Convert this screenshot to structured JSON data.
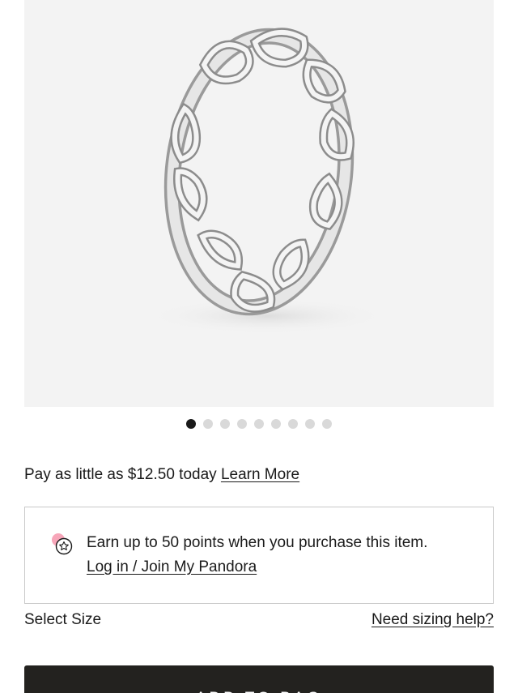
{
  "gallery": {
    "image_alt": "Knotted Heart Ring",
    "next_icon": "chevron-right-icon",
    "slide_count": 9,
    "active_slide": 1
  },
  "payment": {
    "text": "Pay as little as $12.50 today",
    "link": "Learn More"
  },
  "loyalty": {
    "icon": "star-badge-icon",
    "message": "Earn up to 50 points when you purchase this item.",
    "link": "Log in / Join My Pandora"
  },
  "size": {
    "label": "Select Size",
    "help_link": "Need sizing help?"
  },
  "cart": {
    "button_label": "ADD TO BAG"
  },
  "colors": {
    "accent_pink": "#f7a6b9",
    "button_bg": "#23221f"
  }
}
